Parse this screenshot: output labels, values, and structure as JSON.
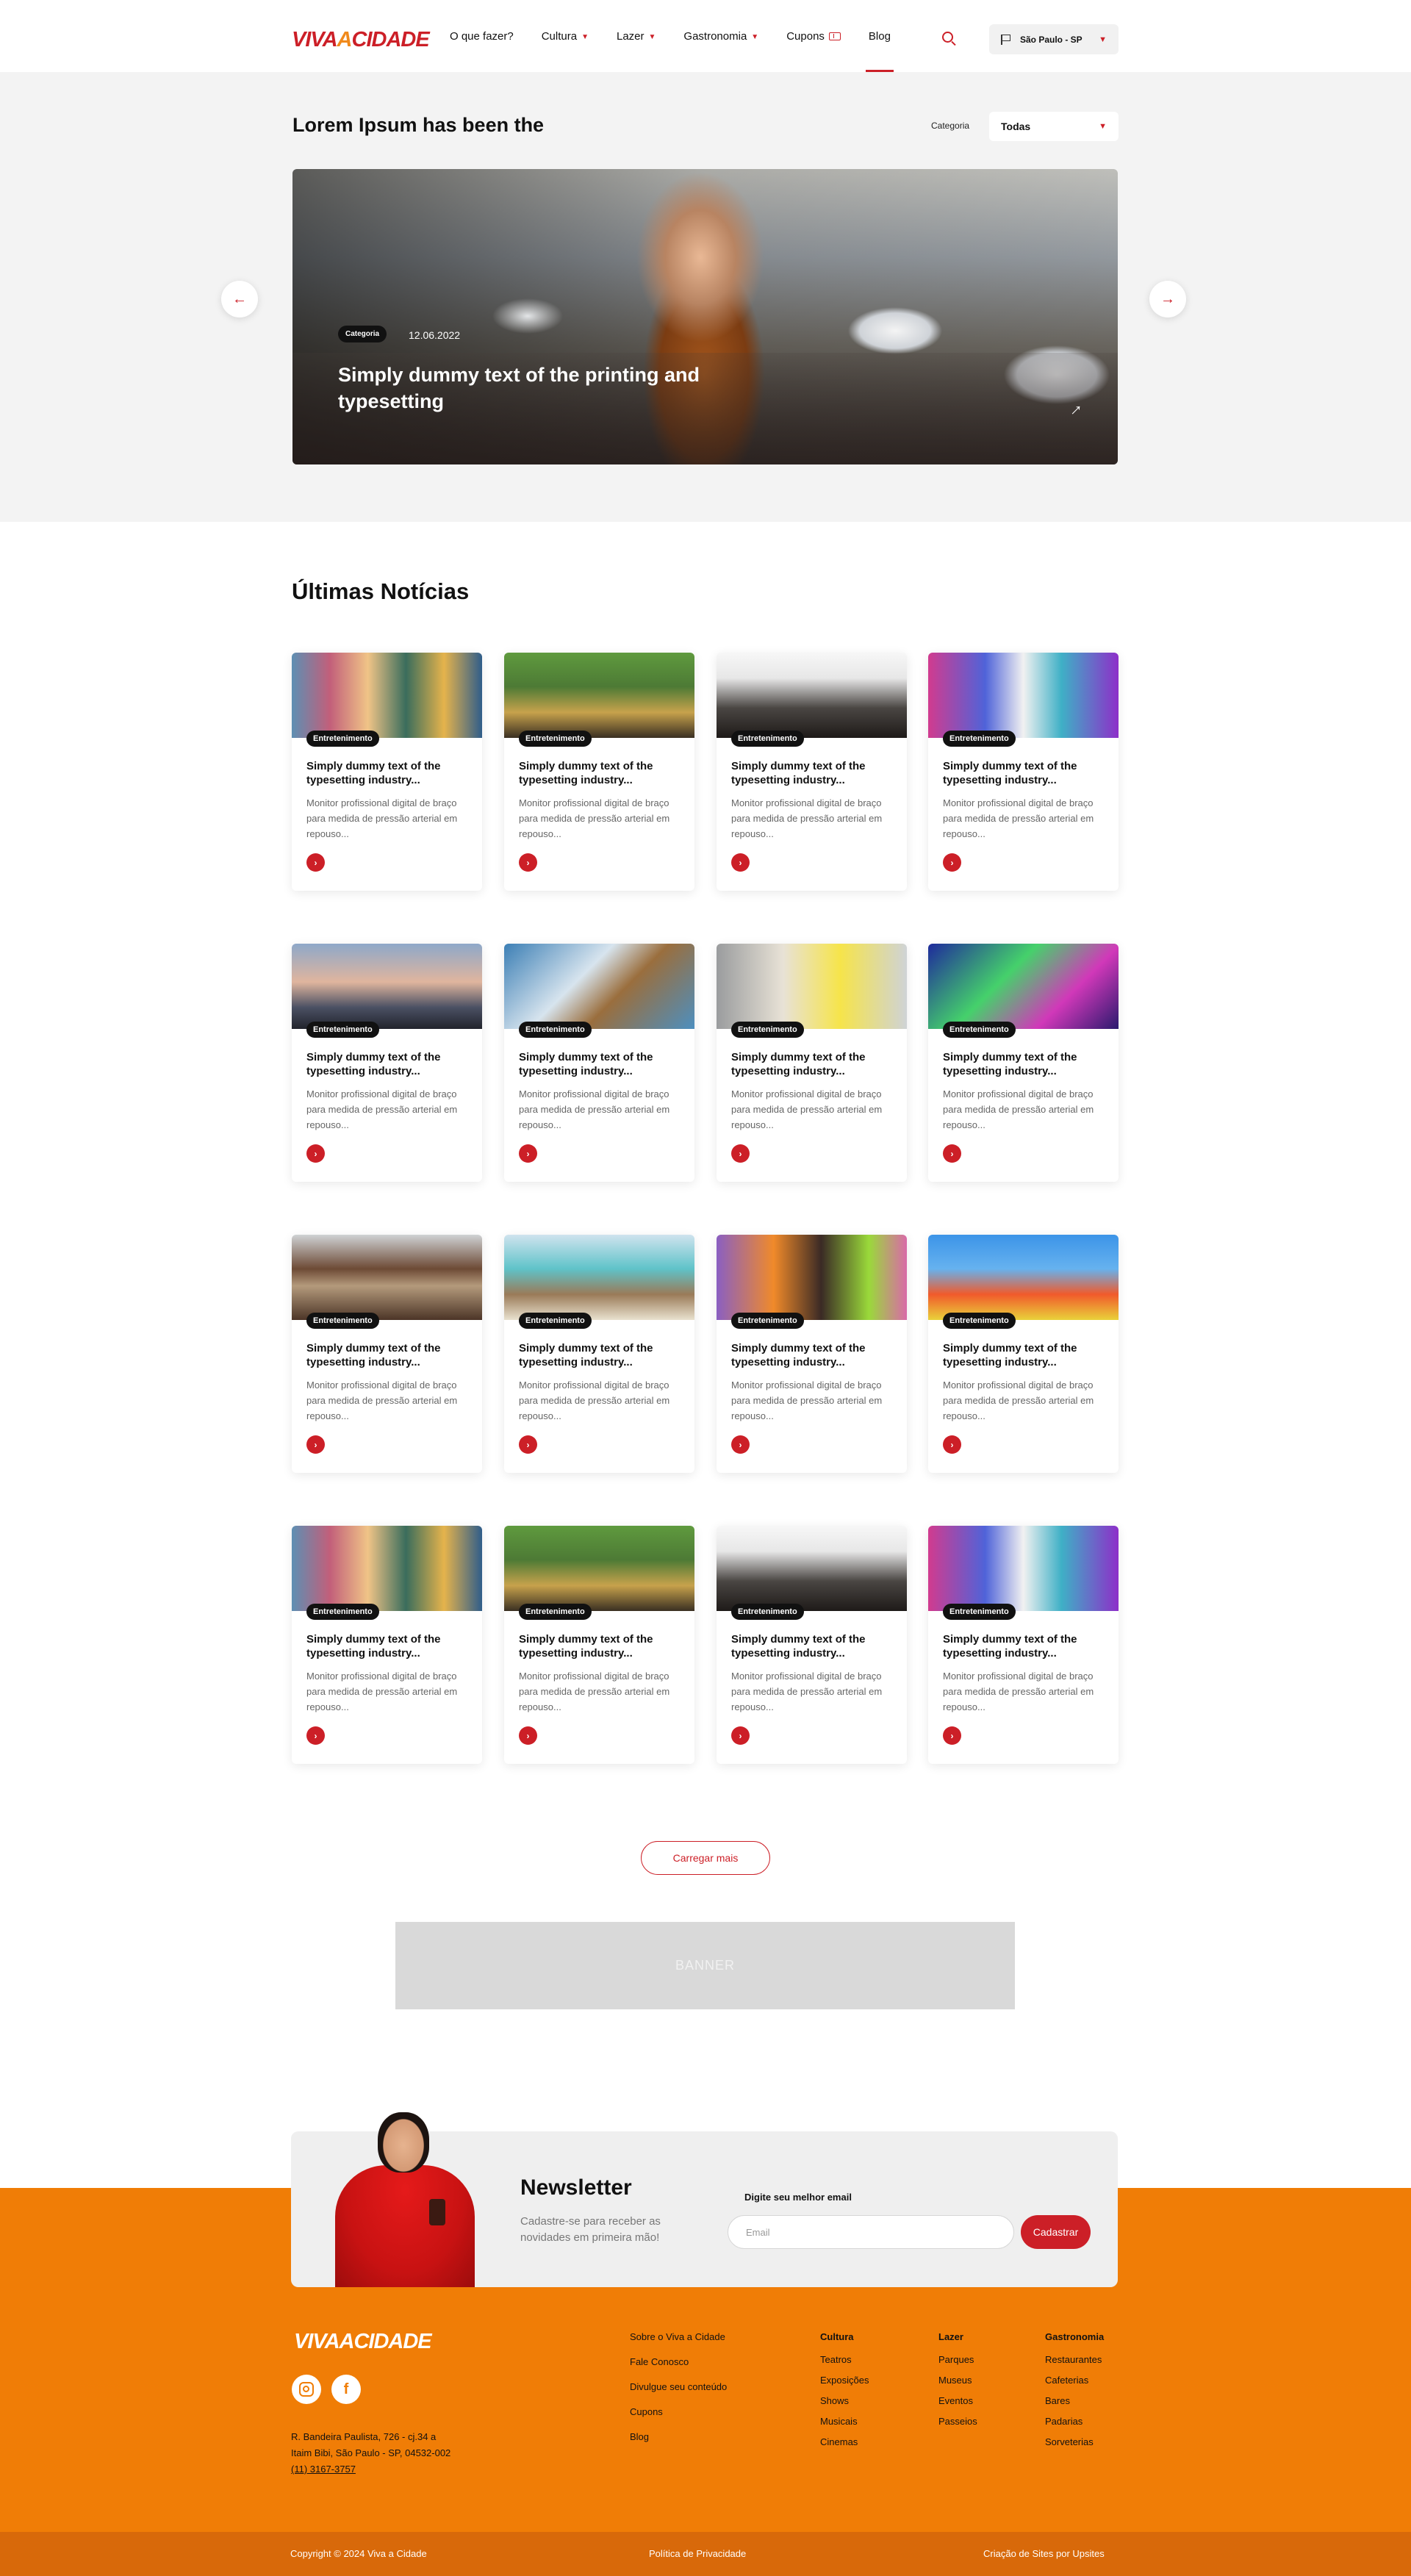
{
  "header": {
    "logo_part1": "VIVA",
    "logo_part2": "A",
    "logo_part3": "CIDADE",
    "nav": [
      {
        "label": "O que fazer?"
      },
      {
        "label": "Cultura"
      },
      {
        "label": "Lazer"
      },
      {
        "label": "Gastronomia"
      },
      {
        "label": "Cupons"
      },
      {
        "label": "Blog"
      }
    ],
    "city": "São Paulo - SP"
  },
  "hero": {
    "title": "Lorem Ipsum has been the",
    "category_label": "Categoria",
    "category_value": "Todas",
    "badge": "Categoria",
    "date": "12.06.2022",
    "headline": "Simply dummy text of the printing and typesetting",
    "prev": "←",
    "next": "→",
    "open_arrow": "→"
  },
  "news": {
    "title": "Últimas Notícias",
    "badge": "Entretenimento",
    "card_title": "Simply dummy text of the typesetting industry...",
    "card_desc": "Monitor profissional digital de braço para medida de pressão arterial em repouso...",
    "go": "›",
    "load_more": "Carregar mais"
  },
  "banner": {
    "label": "BANNER"
  },
  "newsletter": {
    "title": "Newsletter",
    "desc": "Cadastre-se para receber as novidades em primeira mão!",
    "email_label": "Digite seu melhor email",
    "email_placeholder": "Email",
    "submit": "Cadastrar"
  },
  "footer": {
    "logo": "VIVAACIDADE",
    "facebook": "f",
    "address_line1": "R. Bandeira Paulista, 726 - cj.34 a",
    "address_line2": "Itaim Bibi, São Paulo - SP, 04532-002",
    "phone": "(11) 3167-3757",
    "links": [
      "Sobre o Viva a Cidade",
      "Fale Conosco",
      "Divulgue seu conteúdo",
      "Cupons",
      "Blog"
    ],
    "columns": [
      {
        "head": "Cultura",
        "items": [
          "Teatros",
          "Exposições",
          "Shows",
          "Musicais",
          "Cinemas"
        ]
      },
      {
        "head": "Lazer",
        "items": [
          "Parques",
          "Museus",
          "Eventos",
          "Passeios"
        ]
      },
      {
        "head": "Gastronomia",
        "items": [
          "Restaurantes",
          "Cafeterias",
          "Bares",
          "Padarias",
          "Sorveterias"
        ]
      }
    ],
    "copyright": "Copyright © 2024 Viva a Cidade",
    "privacy": "Política de Privacidade",
    "credit": "Criação de Sites por Upsites"
  },
  "colors": {
    "brand_red": "#cc1f27",
    "brand_orange": "#f07d06"
  }
}
